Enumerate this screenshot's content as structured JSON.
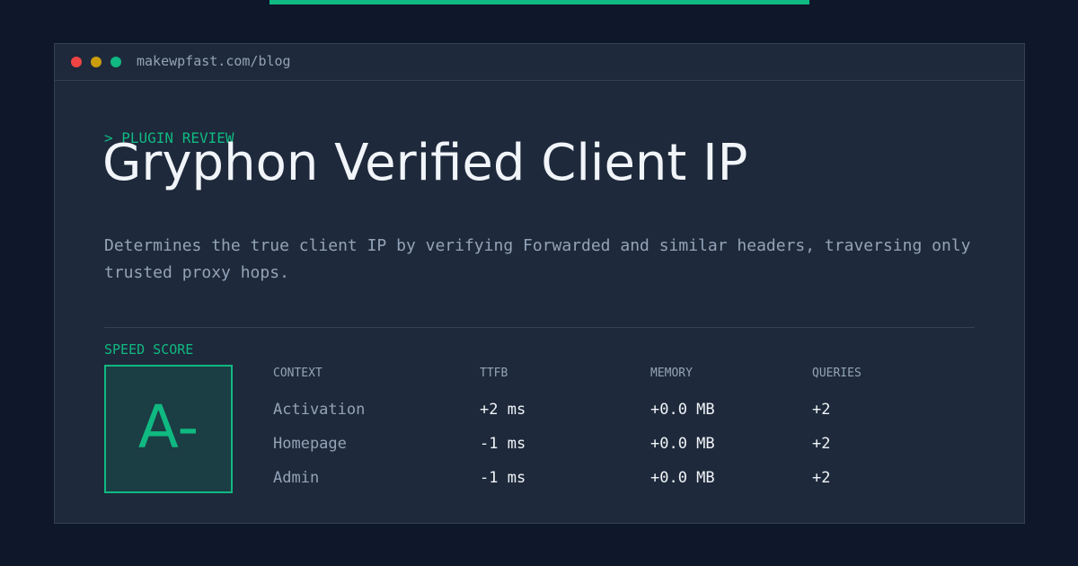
{
  "browser": {
    "url": "makewpfast.com/blog"
  },
  "article": {
    "eyebrow": "> PLUGIN REVIEW",
    "title": "Gryphon Verified Client IP",
    "description": "Determines the true client IP by verifying Forwarded and similar headers, traversing only trusted proxy hops."
  },
  "score": {
    "label": "SPEED SCORE",
    "grade": "A-"
  },
  "metrics": {
    "headers": [
      "CONTEXT",
      "TTFB",
      "MEMORY",
      "QUERIES"
    ],
    "rows": [
      {
        "context": "Activation",
        "ttfb": "+2 ms",
        "memory": "+0.0 MB",
        "queries": "+2"
      },
      {
        "context": "Homepage",
        "ttfb": "-1 ms",
        "memory": "+0.0 MB",
        "queries": "+2"
      },
      {
        "context": "Admin",
        "ttfb": "-1 ms",
        "memory": "+0.0 MB",
        "queries": "+2"
      }
    ]
  },
  "colors": {
    "background": "#0f172a",
    "panel": "#1e293b",
    "accent": "#10b981",
    "muted": "#94a3b8",
    "text": "#f1f5f9"
  }
}
